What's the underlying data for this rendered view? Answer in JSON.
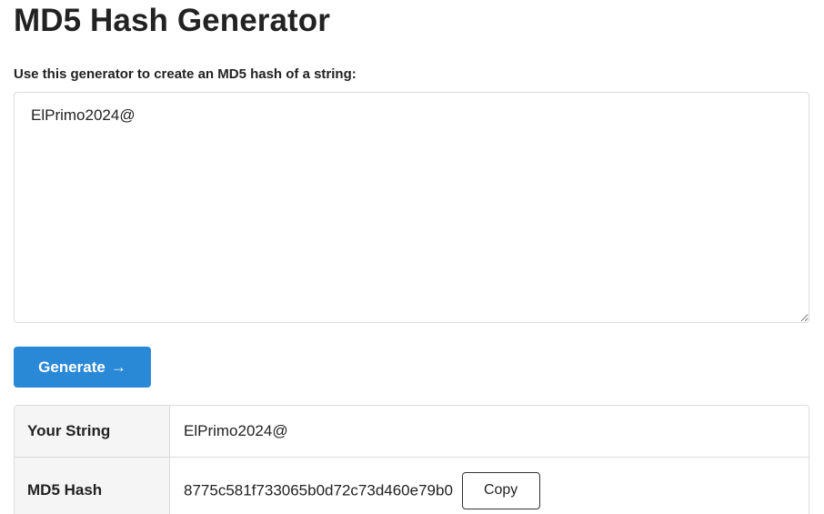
{
  "page": {
    "title": "MD5 Hash Generator",
    "prompt_label": "Use this generator to create an MD5 hash of a string:"
  },
  "input": {
    "value": "ElPrimo2024@"
  },
  "generate_button": {
    "label": "Generate",
    "arrow": "→"
  },
  "results": {
    "rows": [
      {
        "label": "Your String",
        "value": "ElPrimo2024@"
      },
      {
        "label": "MD5 Hash",
        "value": "8775c581f733065b0d72c73d460e79b0"
      }
    ],
    "copy_label": "Copy"
  },
  "colors": {
    "accent": "#2a89d6",
    "border": "#dcdcdc",
    "label_bg": "#f5f5f5"
  }
}
